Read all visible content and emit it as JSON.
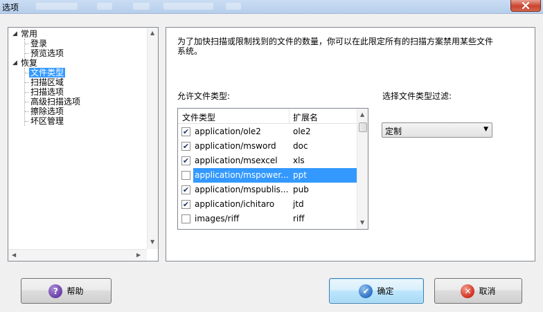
{
  "window": {
    "title": "选项",
    "close_glyph": "✕"
  },
  "tree": {
    "items": [
      {
        "label": "常用",
        "level": 0,
        "expanded": true
      },
      {
        "label": "登录",
        "level": 1
      },
      {
        "label": "预览选项",
        "level": 1
      },
      {
        "label": "恢复",
        "level": 0,
        "expanded": true
      },
      {
        "label": "文件类型",
        "level": 1,
        "selected": true
      },
      {
        "label": "扫描区域",
        "level": 1
      },
      {
        "label": "扫描选项",
        "level": 1
      },
      {
        "label": "高级扫描选项",
        "level": 1
      },
      {
        "label": "擦除选项",
        "level": 1
      },
      {
        "label": "坏区管理",
        "level": 1
      }
    ]
  },
  "content": {
    "description": "为了加快扫描或限制找到的文件的数量，你可以在此限定所有的扫描方案禁用某些文件系统。",
    "allowed_label": "允许文件类型:",
    "filter_label": "选择文件类型过滤:",
    "filter_value": "定制",
    "columns": [
      "文件类型",
      "扩展名"
    ],
    "file_types": [
      {
        "type": "application/ole2",
        "ext": "ole2",
        "checked": true,
        "selected": false
      },
      {
        "type": "application/msword",
        "ext": "doc",
        "checked": true,
        "selected": false
      },
      {
        "type": "application/msexcel",
        "ext": "xls",
        "checked": true,
        "selected": false
      },
      {
        "type": "application/mspower...",
        "ext": "ppt",
        "checked": false,
        "selected": true
      },
      {
        "type": "application/mspublis...",
        "ext": "pub",
        "checked": true,
        "selected": false
      },
      {
        "type": "application/ichitaro",
        "ext": "jtd",
        "checked": true,
        "selected": false
      },
      {
        "type": "images/riff",
        "ext": "riff",
        "checked": false,
        "selected": false
      }
    ]
  },
  "buttons": {
    "help": "帮助",
    "ok": "确定",
    "cancel": "取消"
  },
  "colors": {
    "selection": "#3399ff",
    "help_icon": "#6a3fa8",
    "ok_icon": "#2f73c4",
    "cancel_icon": "#d0301e"
  }
}
